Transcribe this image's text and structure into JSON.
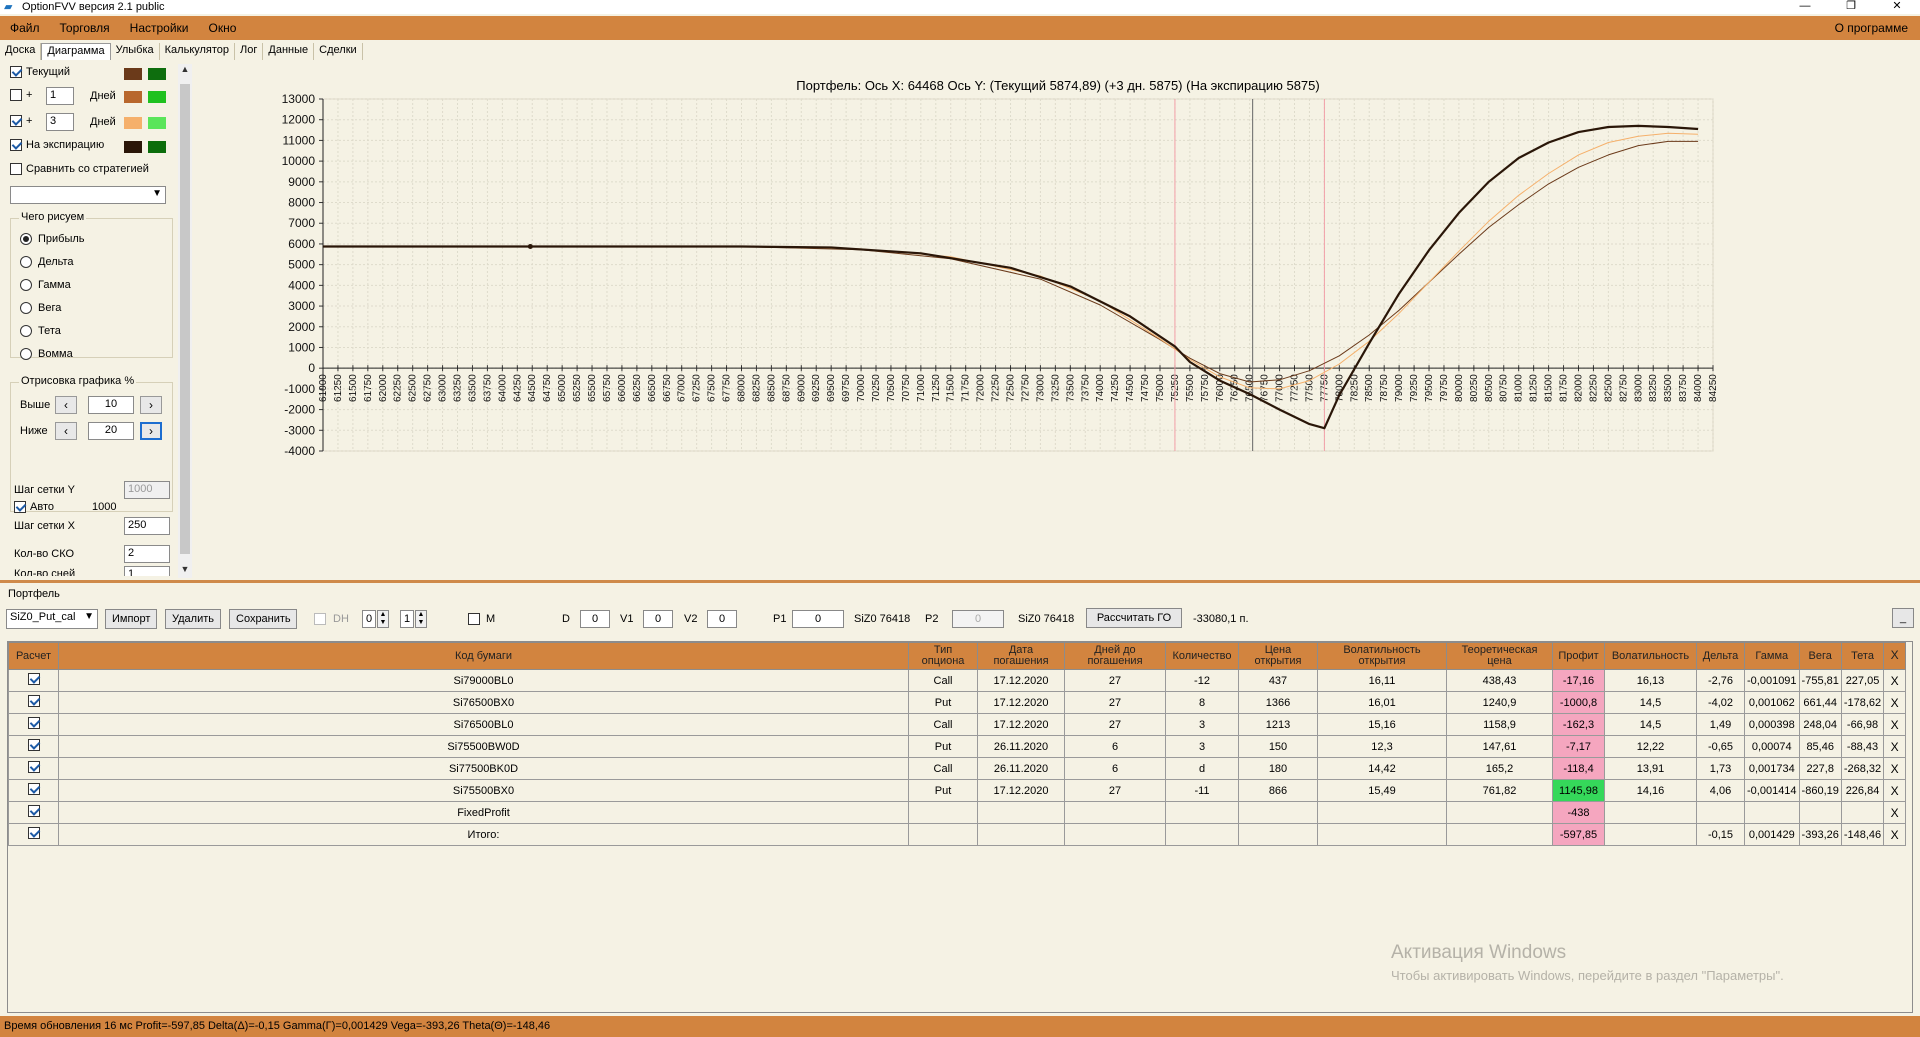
{
  "window": {
    "title": "OptionFVV версия 2.1 public",
    "about": "О программе"
  },
  "menu": [
    "Файл",
    "Торговля",
    "Настройки",
    "Окно"
  ],
  "tabs": [
    "Доска",
    "Диаграмма",
    "Улыбка",
    "Калькулятор",
    "Лог",
    "Данные",
    "Сделки"
  ],
  "left": {
    "current_label": "Текущий",
    "plus": "+",
    "plus1_value": "1",
    "plus2_value": "3",
    "days_label": "Дней",
    "expiry_label": "На экспирацию",
    "compare_label": "Сравнить со стратегией",
    "what_label": "Чего рисуем",
    "radios": [
      "Прибыль",
      "Дельта",
      "Гамма",
      "Вега",
      "Тета",
      "Вомма"
    ],
    "draw_label": "Отрисовка графика %",
    "above_label": "Выше",
    "above_value": "10",
    "below_label": "Ниже",
    "below_value": "20",
    "stepY_label": "Шаг сетки Y",
    "stepY_value": "1000",
    "auto_label": "Авто",
    "auto_value": "1000",
    "stepX_label": "Шаг сетки X",
    "stepX_value": "250",
    "sko_label": "Кол-во СКО",
    "sko_value": "2",
    "count_label": "Кол-во сней",
    "count_value": "1",
    "colors": {
      "current": [
        "#6b3a1a",
        "#0e6e0e"
      ],
      "plus1": [
        "#b8672d",
        "#1fc11f"
      ],
      "plus3": [
        "#f5b06b",
        "#5ae55a"
      ],
      "expiry": [
        "#2a1608",
        "#0b6d0b"
      ]
    }
  },
  "chart_title": "Портфель: Ось X: 64468 Ось Y:  (Текущий 5874,89)  (+3 дн. 5875)  (На экспирацию 5875)",
  "chart_data": {
    "type": "line",
    "title": "Портфель: Ось X: 64468 Ось Y:  (Текущий 5874,89)  (+3 дн. 5875)  (На экспирацию 5875)",
    "xlim": [
      61000,
      84250
    ],
    "ylim": [
      -4000,
      13000
    ],
    "x_tick_step": 250,
    "y_ticks": [
      13000,
      12000,
      11000,
      10000,
      9000,
      8000,
      7000,
      6000,
      5000,
      4000,
      3000,
      2000,
      1000,
      0,
      -1000,
      -2000,
      -3000,
      -4000
    ],
    "grid": true,
    "markers": {
      "cursor_x": 76550,
      "point": [
        64468,
        5875
      ]
    },
    "std_lines": [
      75250,
      77750
    ],
    "series": [
      {
        "name": "Текущий",
        "color": "#6b3a1a",
        "x": [
          61000,
          68000,
          70000,
          71500,
          73000,
          74000,
          75000,
          75500,
          76000,
          76500,
          77000,
          77500,
          78000,
          78500,
          79000,
          79500,
          80000,
          80500,
          81000,
          81500,
          82000,
          82500,
          83000,
          83500,
          84000
        ],
        "y": [
          5875,
          5870,
          5720,
          5280,
          4300,
          3050,
          1380,
          480,
          -260,
          -670,
          -560,
          -120,
          600,
          1600,
          2800,
          4150,
          5500,
          6800,
          7900,
          8900,
          9700,
          10300,
          10750,
          10950,
          10950
        ]
      },
      {
        "name": "+3 дн.",
        "color": "#f5b06b",
        "x": [
          61000,
          68000,
          70000,
          71500,
          73000,
          74000,
          75000,
          75500,
          76000,
          76500,
          77000,
          77500,
          78000,
          78500,
          79000,
          79500,
          80000,
          80500,
          81000,
          81500,
          82000,
          82500,
          83000,
          83500,
          84000
        ],
        "y": [
          5875,
          5872,
          5760,
          5380,
          4450,
          3250,
          1420,
          420,
          -420,
          -950,
          -1000,
          -600,
          200,
          1300,
          2650,
          4150,
          5650,
          7100,
          8350,
          9400,
          10300,
          10900,
          11200,
          11350,
          11300
        ]
      },
      {
        "name": "На экспирацию",
        "color": "#2a1608",
        "x": [
          61000,
          68000,
          69500,
          71000,
          72500,
          73500,
          74500,
          75250,
          75500,
          76000,
          76500,
          77000,
          77500,
          77750,
          78000,
          78500,
          79000,
          79500,
          80000,
          80500,
          81000,
          81500,
          82000,
          82500,
          83000,
          83500,
          84000
        ],
        "y": [
          5875,
          5875,
          5830,
          5550,
          4850,
          3950,
          2500,
          1050,
          300,
          -600,
          -1250,
          -2000,
          -2700,
          -2900,
          -1300,
          1200,
          3600,
          5700,
          7500,
          9000,
          10150,
          10900,
          11400,
          11650,
          11700,
          11650,
          11550
        ]
      }
    ]
  },
  "portfolio_label": "Портфель",
  "toolbar": {
    "portfolio_select": "SiZ0_Put_cal",
    "import": "Импорт",
    "delete": "Удалить",
    "save": "Сохранить",
    "dh_label": "DH",
    "dh_v1": "0",
    "dh_v2": "1",
    "m_label": "M",
    "d_label": "D",
    "d_value": "0",
    "v1_label": "V1",
    "v1_value": "0",
    "v2_label": "V2",
    "v2_value": "0",
    "p1_label": "P1",
    "p1_value": "0",
    "p1_price": "SiZ0 76418",
    "p2_label": "P2",
    "p2_value": "0",
    "p2_price": "SiZ0 76418",
    "calc_go": "Рассчитать ГО",
    "go_value": "-33080,1 п.",
    "minimize": "_"
  },
  "table": {
    "headers": [
      "Расчет",
      "Код бумаги",
      "Тип опциона",
      "Дата погашения",
      "Дней до погашения",
      "Количество",
      "Цена открытия",
      "Волатильность открытия",
      "Теоретическая цена",
      "Профит",
      "Волатильность",
      "Дельта",
      "Гамма",
      "Вега",
      "Тета",
      ""
    ],
    "rows": [
      {
        "code": "Si79000BL0",
        "type": "Call",
        "date": "17.12.2020",
        "days": "27",
        "qty": "-12",
        "price": "437",
        "vol_open": "16,11",
        "theo": "438,43",
        "profit": "-17,16",
        "profit_class": "neg",
        "vol": "16,13",
        "delta": "-2,76",
        "gamma": "-0,001091",
        "vega": "-755,81",
        "theta": "227,05"
      },
      {
        "code": "Si76500BX0",
        "type": "Put",
        "date": "17.12.2020",
        "days": "27",
        "qty": "8",
        "price": "1366",
        "vol_open": "16,01",
        "theo": "1240,9",
        "profit": "-1000,8",
        "profit_class": "neg",
        "vol": "14,5",
        "delta": "-4,02",
        "gamma": "0,001062",
        "vega": "661,44",
        "theta": "-178,62"
      },
      {
        "code": "Si76500BL0",
        "type": "Call",
        "date": "17.12.2020",
        "days": "27",
        "qty": "3",
        "price": "1213",
        "vol_open": "15,16",
        "theo": "1158,9",
        "profit": "-162,3",
        "profit_class": "neg",
        "vol": "14,5",
        "delta": "1,49",
        "gamma": "0,000398",
        "vega": "248,04",
        "theta": "-66,98"
      },
      {
        "code": "Si75500BW0D",
        "type": "Put",
        "date": "26.11.2020",
        "days": "6",
        "qty": "3",
        "price": "150",
        "vol_open": "12,3",
        "theo": "147,61",
        "profit": "-7,17",
        "profit_class": "neg",
        "vol": "12,22",
        "delta": "-0,65",
        "gamma": "0,00074",
        "vega": "85,46",
        "theta": "-88,43"
      },
      {
        "code": "Si77500BK0D",
        "type": "Call",
        "date": "26.11.2020",
        "days": "6",
        "qty": "d",
        "price": "180",
        "vol_open": "14,42",
        "theo": "165,2",
        "profit": "-118,4",
        "profit_class": "neg",
        "vol": "13,91",
        "delta": "1,73",
        "gamma": "0,001734",
        "vega": "227,8",
        "theta": "-268,32"
      },
      {
        "code": "Si75500BX0",
        "type": "Put",
        "date": "17.12.2020",
        "days": "27",
        "qty": "-11",
        "price": "866",
        "vol_open": "15,49",
        "theo": "761,82",
        "profit": "1145,98",
        "profit_class": "pos",
        "vol": "14,16",
        "delta": "4,06",
        "gamma": "-0,001414",
        "vega": "-860,19",
        "theta": "226,84"
      },
      {
        "code": "FixedProfit",
        "type": "",
        "date": "",
        "days": "",
        "qty": "",
        "price": "",
        "vol_open": "",
        "theo": "",
        "profit": "-438",
        "profit_class": "neg",
        "vol": "",
        "delta": "",
        "gamma": "",
        "vega": "",
        "theta": ""
      },
      {
        "code": "Итого:",
        "type": "",
        "date": "",
        "days": "",
        "qty": "",
        "price": "",
        "vol_open": "",
        "theo": "",
        "profit": "-597,85",
        "profit_class": "neg",
        "vol": "",
        "delta": "-0,15",
        "gamma": "0,001429",
        "vega": "-393,26",
        "theta": "-148,46"
      }
    ],
    "remove_glyph": "X"
  },
  "watermark": {
    "title": "Активация Windows",
    "subtitle": "Чтобы активировать Windows, перейдите в раздел \"Параметры\"."
  },
  "status": "Время обновления 16 мс  Profit=-597,85 Delta(Δ)=-0,15 Gamma(Γ)=0,001429 Vega=-393,26 Theta(Θ)=-148,46"
}
